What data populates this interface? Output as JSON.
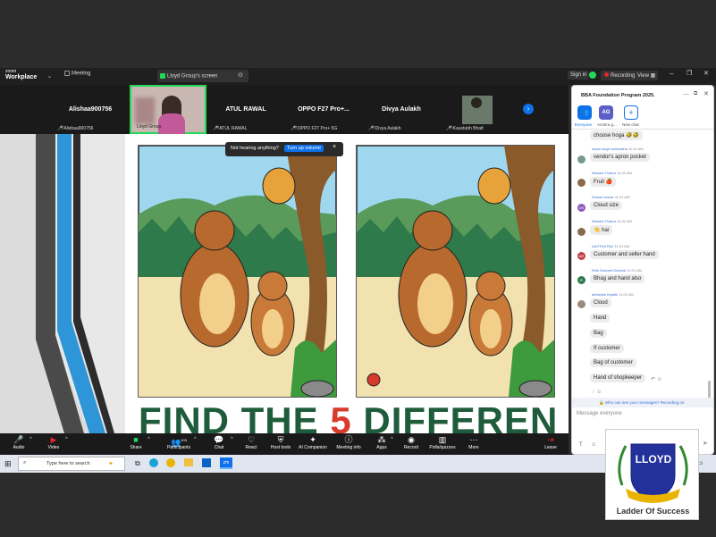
{
  "app": {
    "logo_small": "zoom",
    "logo_main": "Workplace",
    "tab_meeting": "Meeting",
    "tab_screen": "Lloyd Group's screen"
  },
  "titlebar": {
    "signin": "Sign in",
    "recording": "Recording",
    "view": "View"
  },
  "gallery": [
    {
      "name": "Alishaa900756",
      "foot": "Alishaa900756"
    },
    {
      "name": "",
      "foot": "Lloyd Group"
    },
    {
      "name": "ATUL RAWAL",
      "foot": "ATUL RAWAL"
    },
    {
      "name": "OPPO F27 Pro+...",
      "foot": "OPPO F27 Pro+ 5G"
    },
    {
      "name": "Divya Aulakh",
      "foot": "Divya Aulakh"
    },
    {
      "name": "",
      "foot": "Kaustubh Bhatt"
    }
  ],
  "notice": {
    "text": "Not hearing anything?",
    "button": "Turn up volume",
    "close": "×"
  },
  "slide": {
    "headline_a": "FIND THE ",
    "headline_num": "5",
    "headline_b": " DIFFERENCES"
  },
  "toolbar": [
    {
      "icon": "mic-icon",
      "label": "Audio"
    },
    {
      "icon": "video-icon",
      "label": "Video"
    },
    {
      "icon": "share-icon",
      "label": "Share"
    },
    {
      "icon": "participants-icon",
      "label": "Participants",
      "count": "103"
    },
    {
      "icon": "chat-icon",
      "label": "Chat"
    },
    {
      "icon": "react-icon",
      "label": "React"
    },
    {
      "icon": "host-tools-icon",
      "label": "Host tools"
    },
    {
      "icon": "ai-companion-icon",
      "label": "AI Companion"
    },
    {
      "icon": "meeting-info-icon",
      "label": "Meeting info"
    },
    {
      "icon": "apps-icon",
      "label": "Apps"
    },
    {
      "icon": "record-icon",
      "label": "Record"
    },
    {
      "icon": "polls-icon",
      "label": "Polls/quizzes"
    },
    {
      "icon": "more-icon",
      "label": "More"
    },
    {
      "icon": "leave-icon",
      "label": "Leave"
    }
  ],
  "chat": {
    "title": "BBA Foundation Program 2025.",
    "tabs": [
      {
        "label": "Everyone"
      },
      {
        "label": "Anshra g..."
      },
      {
        "label": "New chat"
      }
    ],
    "messages": [
      {
        "sender": "",
        "time": "",
        "text": "choose hoga 🤣🤣"
      },
      {
        "sender": "aryan singh kushwaha",
        "time": "11:01 AM",
        "text": "vendor's apron pocket"
      },
      {
        "sender": "Nishant Thakur",
        "time": "11:01 AM",
        "text": "Fruit 🍎"
      },
      {
        "sender": "Dinesh kumar",
        "time": "11:01 AM",
        "text": "Cloud size"
      },
      {
        "sender": "Nishant Thakur",
        "time": "11:01 AM",
        "text": "👋 hai"
      },
      {
        "sender": "AASTHA RAJ",
        "time": "11:01 AM",
        "text": "Customer and seller hand"
      },
      {
        "sender": "Rhik Dwivedi Dwivedi",
        "time": "11:01 AM",
        "text": "Bhag and hand also"
      },
      {
        "sender": "abhishek tripathi",
        "time": "11:01 AM",
        "text": "Cloud"
      },
      {
        "sender": "",
        "time": "",
        "text": "Hand"
      },
      {
        "sender": "",
        "time": "",
        "text": "Bag"
      },
      {
        "sender": "",
        "time": "",
        "text": "If customer"
      },
      {
        "sender": "",
        "time": "",
        "text": "Bag of customer"
      },
      {
        "sender": "",
        "time": "",
        "text": "Hand of shopkeeper"
      }
    ],
    "privacy": "Who can see your messages? Recording on",
    "input_placeholder": "Message everyone"
  },
  "taskbar": {
    "search_placeholder": "Type here to search"
  },
  "watermark": {
    "name": "LLOYD",
    "ribbon": "LLOYD",
    "tagline": "Ladder Of Success"
  },
  "colors": {
    "accent": "#0e71eb",
    "record": "#e02828",
    "green": "#23d959",
    "headline": "#1f5c3c",
    "headline_num": "#d93a2b"
  }
}
